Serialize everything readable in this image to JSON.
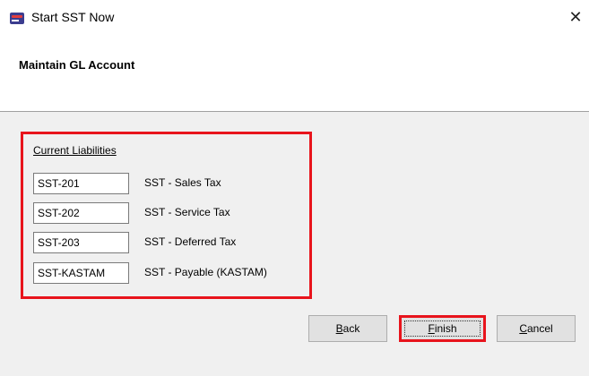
{
  "window": {
    "title": "Start SST Now",
    "close_glyph": "✕"
  },
  "header": {
    "title": "Maintain GL Account"
  },
  "group": {
    "title": "Current Liabilities",
    "rows": [
      {
        "code": "SST-201",
        "description": "SST - Sales Tax"
      },
      {
        "code": "SST-202",
        "description": "SST - Service Tax"
      },
      {
        "code": "SST-203",
        "description": "SST - Deferred Tax"
      },
      {
        "code": "SST-KASTAM",
        "description": "SST - Payable (KASTAM)"
      }
    ]
  },
  "buttons": {
    "back": {
      "accel": "B",
      "rest": "ack"
    },
    "finish": {
      "accel": "F",
      "rest": "inish"
    },
    "cancel": {
      "accel": "C",
      "rest": "ancel"
    }
  },
  "colors": {
    "highlight": "#e8141c",
    "panel": "#f0f0f0"
  },
  "icons": {
    "app": "app-icon",
    "close": "close-icon"
  }
}
